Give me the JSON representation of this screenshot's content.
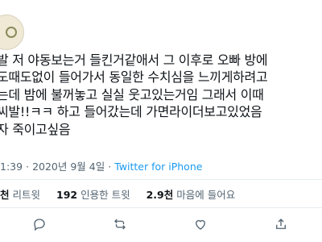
{
  "tweet": {
    "lines": [
      "발 저 야동보는거 들킨거같애서 그 이후로 오빠 방에",
      "도때도없이 들어가서 동일한 수치심을 느끼게하려고",
      "는데 밤에 불꺼놓고 실실 웃고있는거임 그래서 이때",
      "씨발!!ㅋㅋ 하고 들어갔는데 가면라이더보고있었음",
      "자 죽이고싶음"
    ],
    "time": "1:39",
    "date": "2020년 9월 4일",
    "source": "Twitter for iPhone"
  },
  "stats": {
    "retweets_count": "천",
    "retweets_label": "리트윗",
    "quotes_count": "192",
    "quotes_label": "인용한 트윗",
    "likes_count": "2.9천",
    "likes_label": "마음에 들어요"
  },
  "icons": {
    "reply": "reply-icon",
    "retweet": "retweet-icon",
    "like": "heart-icon",
    "share": "share-icon"
  },
  "colors": {
    "text": "#0f1419",
    "secondary": "#536471",
    "link": "#1d9bf0",
    "divider": "#e6ecf0"
  }
}
